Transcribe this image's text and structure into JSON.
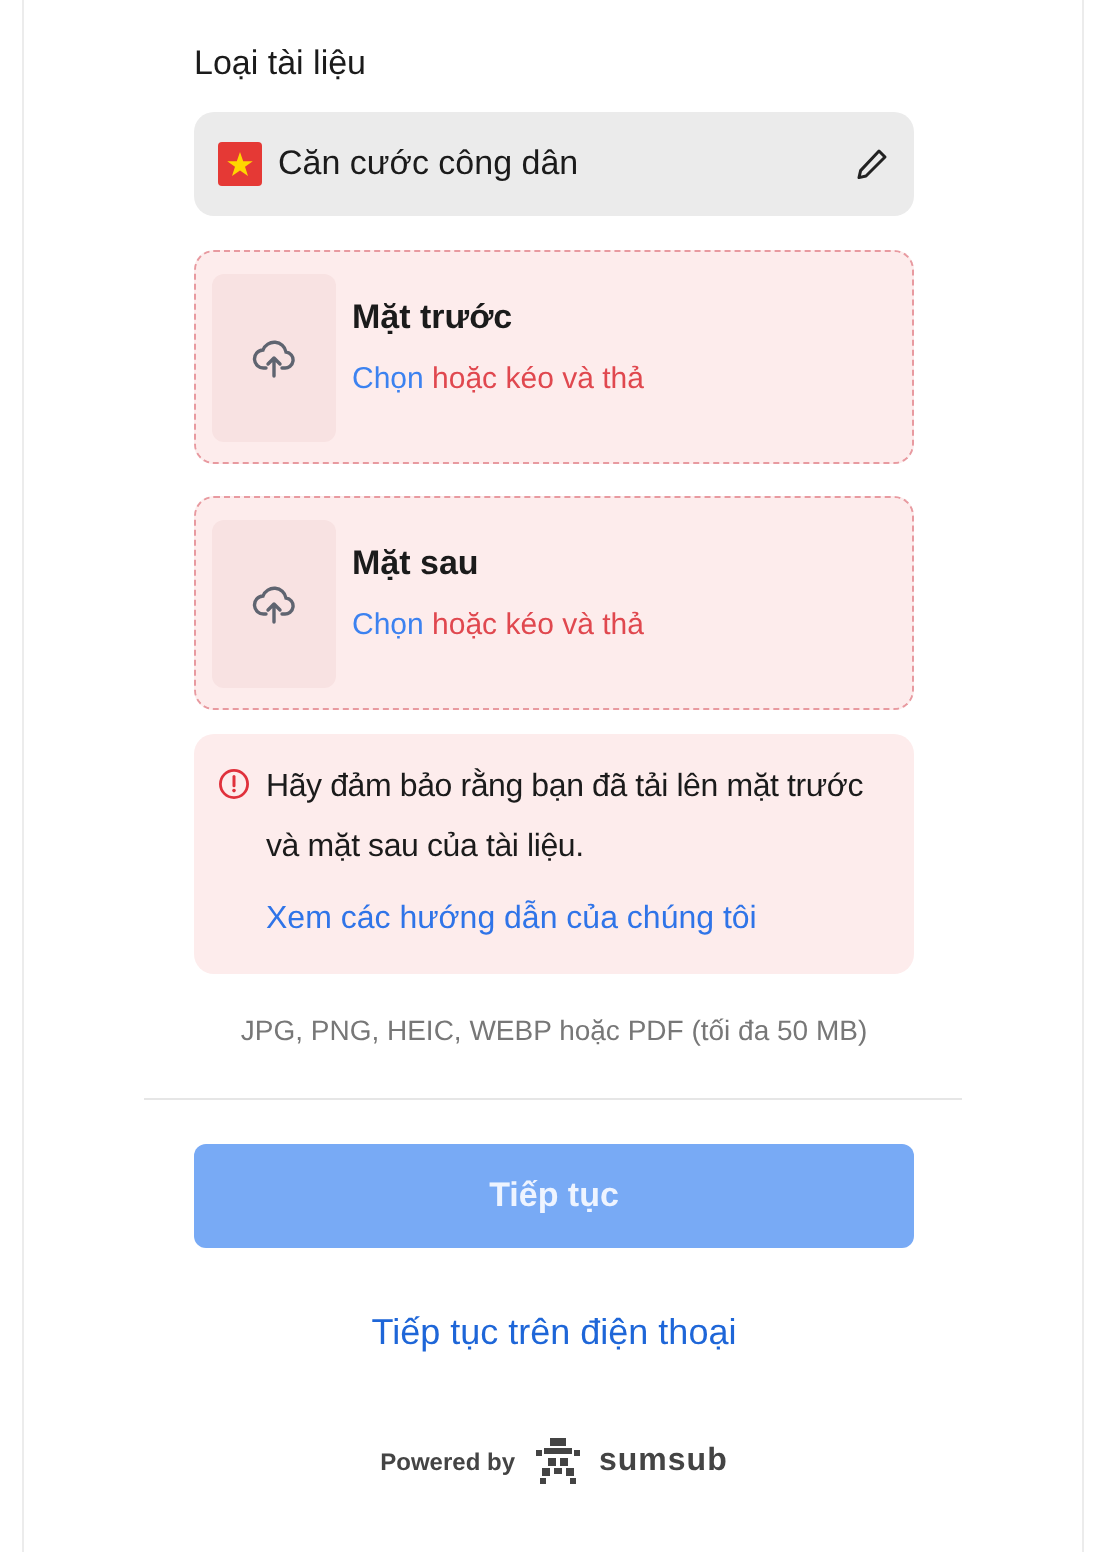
{
  "document_type": {
    "label": "Loại tài liệu",
    "value": "Căn cước công dân"
  },
  "uploads": [
    {
      "title": "Mặt trước",
      "choose": "Chọn",
      "drag": "hoặc kéo và thả"
    },
    {
      "title": "Mặt sau",
      "choose": "Chọn",
      "drag": "hoặc kéo và thả"
    }
  ],
  "alert": {
    "message": "Hãy đảm bảo rằng bạn đã tải lên mặt trước và mặt sau của tài liệu.",
    "link": "Xem các hướng dẫn của chúng tôi"
  },
  "formats": "JPG, PNG, HEIC, WEBP hoặc PDF (tối đa 50 MB)",
  "continue_button": {
    "label": "Tiếp tục",
    "disabled": true
  },
  "phone_link": "Tiếp tục trên điện thoại",
  "footer": {
    "powered_by": "Powered by",
    "brand": "sumsub"
  }
}
